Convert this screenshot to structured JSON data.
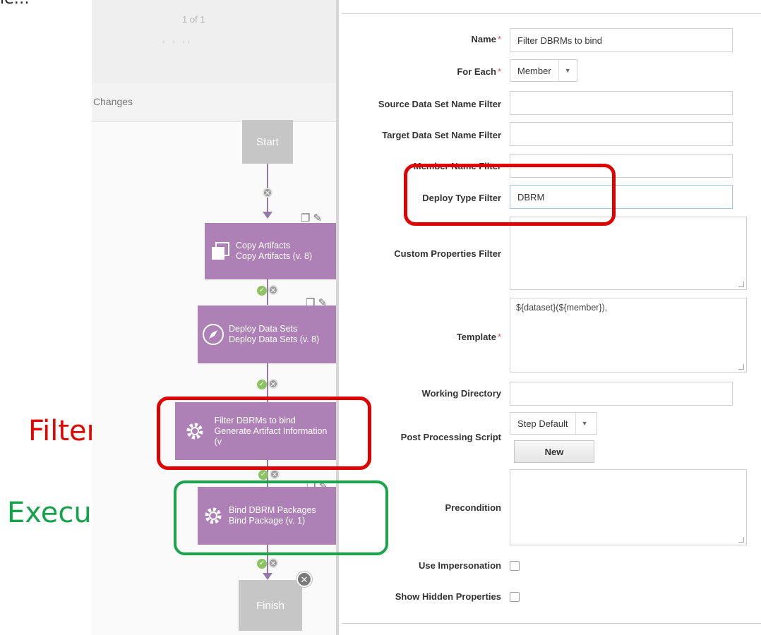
{
  "slide_caption": "le…",
  "annotations": {
    "filter": "Filter",
    "execute": "Execute"
  },
  "workflow": {
    "pager_text": "1 of 1",
    "pager_arrows": "‹ › ››",
    "changes_label": "Changes",
    "start_label": "Start",
    "finish_label": "Finish",
    "steps": [
      {
        "title": "Copy Artifacts",
        "subtitle": "Copy Artifacts (v. 8)",
        "icon": "copy-icon"
      },
      {
        "title": "Deploy Data Sets",
        "subtitle": "Deploy Data Sets (v. 8)",
        "icon": "rocket-icon"
      },
      {
        "title": "Filter DBRMs to bind",
        "subtitle": "Generate Artifact Information (v",
        "icon": "gear-icon"
      },
      {
        "title": "Bind DBRM Packages",
        "subtitle": "Bind Package (v. 1)",
        "icon": "gear-icon"
      }
    ]
  },
  "form": {
    "name_label": "Name",
    "name_value": "Filter DBRMs to bind",
    "for_each_label": "For Each",
    "for_each_value": "Member",
    "source_filter_label": "Source Data Set Name Filter",
    "source_filter_value": "",
    "target_filter_label": "Target Data Set Name Filter",
    "target_filter_value": "",
    "member_filter_label": "Member Name Filter",
    "member_filter_value": "",
    "deploy_type_label": "Deploy Type Filter",
    "deploy_type_value": "DBRM",
    "custom_props_label": "Custom Properties Filter",
    "custom_props_value": "",
    "template_label": "Template",
    "template_value": "${dataset}(${member}),",
    "working_dir_label": "Working Directory",
    "working_dir_value": "",
    "post_script_label": "Post Processing Script",
    "post_script_value": "Step Default",
    "new_button": "New",
    "precondition_label": "Precondition",
    "precondition_value": "",
    "impersonation_label": "Use Impersonation",
    "hidden_props_label": "Show Hidden Properties",
    "required_mark": "*"
  },
  "colors": {
    "node_purple": "#ad80b6",
    "node_gray": "#c6c6c6",
    "highlight_red": "#e00000",
    "highlight_green": "#19a64b"
  }
}
